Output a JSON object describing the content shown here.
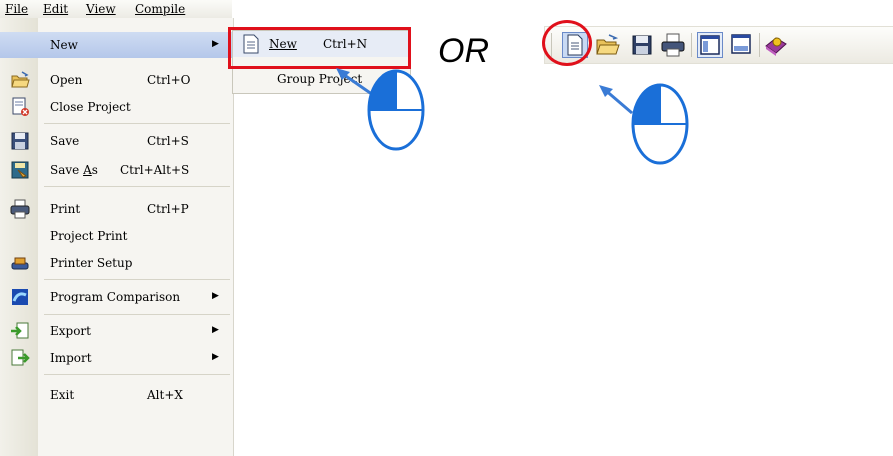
{
  "menubar": {
    "items": [
      "File",
      "Edit",
      "View",
      "Compile"
    ]
  },
  "file_menu": {
    "new": {
      "label": "New",
      "has_submenu": true
    },
    "open": {
      "label": "Open",
      "shortcut": "Ctrl+O"
    },
    "close_project": {
      "label": "Close Project"
    },
    "save": {
      "label": "Save",
      "shortcut": "Ctrl+S"
    },
    "save_as": {
      "label_prefix": "Save ",
      "label_accel": "A",
      "label_suffix": "s",
      "shortcut": "Ctrl+Alt+S"
    },
    "print": {
      "label": "Print",
      "shortcut": "Ctrl+P"
    },
    "project_print": {
      "label": "Project Print"
    },
    "printer_setup": {
      "label": "Printer Setup"
    },
    "program_comparison": {
      "label": "Program Comparison",
      "has_submenu": true
    },
    "export": {
      "label": "Export",
      "has_submenu": true
    },
    "import": {
      "label": "Import",
      "has_submenu": true
    },
    "exit": {
      "label": "Exit",
      "shortcut": "Alt+X"
    }
  },
  "submenu": {
    "new": {
      "label": "New",
      "shortcut": "Ctrl+N"
    },
    "group_project": {
      "label": "Group Project"
    }
  },
  "or_text": "OR",
  "toolbar": {
    "icons": [
      "new-file-icon",
      "open-folder-icon",
      "save-icon",
      "print-icon",
      "project-view-icon",
      "window-view-icon",
      "help-book-icon"
    ]
  },
  "colors": {
    "highlight_red": "#e0101b",
    "arrow_blue": "#3a7bd5",
    "cursor_blue": "#1a6fd8",
    "menu_highlight": "#b4c7ea"
  }
}
